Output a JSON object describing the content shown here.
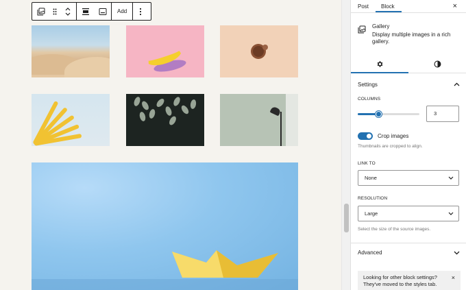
{
  "toolbar": {
    "add_label": "Add",
    "icons": [
      "gallery-icon",
      "drag-handle-icon",
      "move-up-icon",
      "move-down-icon",
      "align-icon",
      "caption-icon",
      "more-options-icon"
    ]
  },
  "sidebar": {
    "tabs": {
      "post": "Post",
      "block": "Block",
      "active": "Block"
    },
    "close_icon": "×",
    "block": {
      "name": "Gallery",
      "description": "Display multiple images in a rich gallery."
    },
    "settings_heading": "Settings",
    "columns": {
      "label": "COLUMNS",
      "value": "3",
      "slider_fraction": 0.33
    },
    "crop": {
      "label": "Crop images",
      "checked": true,
      "help": "Thumbnails are cropped to align."
    },
    "link_to": {
      "label": "LINK TO",
      "value": "None"
    },
    "resolution": {
      "label": "RESOLUTION",
      "value": "Large",
      "help": "Select the size of the source images."
    },
    "advanced_heading": "Advanced",
    "notice": {
      "text": "Looking for other block settings? They've moved to the styles tab.",
      "close_icon": "×"
    }
  },
  "gallery": {
    "images": [
      "desert",
      "banana",
      "coffee",
      "yellow-leaf",
      "plant",
      "lamp",
      "paper-boat"
    ]
  },
  "colors": {
    "accent": "#2271b1",
    "canvas": "#f5f3ee"
  }
}
